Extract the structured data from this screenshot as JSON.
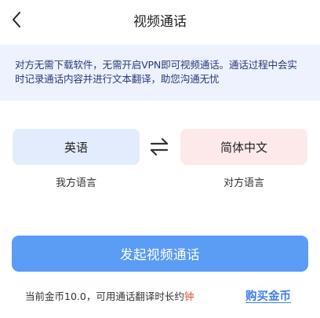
{
  "nav": {
    "back_icon": "chevron-left-icon",
    "title": "视频通话"
  },
  "notice": {
    "text": "对方无需下载软件，无需开启VPN即可视频通话。通话过程中会实时记录通话内容并进行文本翻译，助您沟通无忧"
  },
  "languages": {
    "mine": {
      "value": "英语",
      "caption": "我方语言"
    },
    "swap_icon": "swap-arrows-icon",
    "peer": {
      "value": "简体中文",
      "caption": "对方语言"
    }
  },
  "actions": {
    "start_call_label": "发起视频通话"
  },
  "footer": {
    "balance_prefix": "当前金币10.0，可用通话翻译时长约",
    "balance_unit": "钟",
    "buy_link": "购买金币"
  },
  "colors": {
    "primary_button": "#5b9cf5",
    "notice_bg": "#eef2fe",
    "mine_lang_bg": "#e3ecfd",
    "peer_lang_bg": "#fde9ea",
    "link": "#3f7ee8",
    "accent_red": "#e74c3c"
  }
}
